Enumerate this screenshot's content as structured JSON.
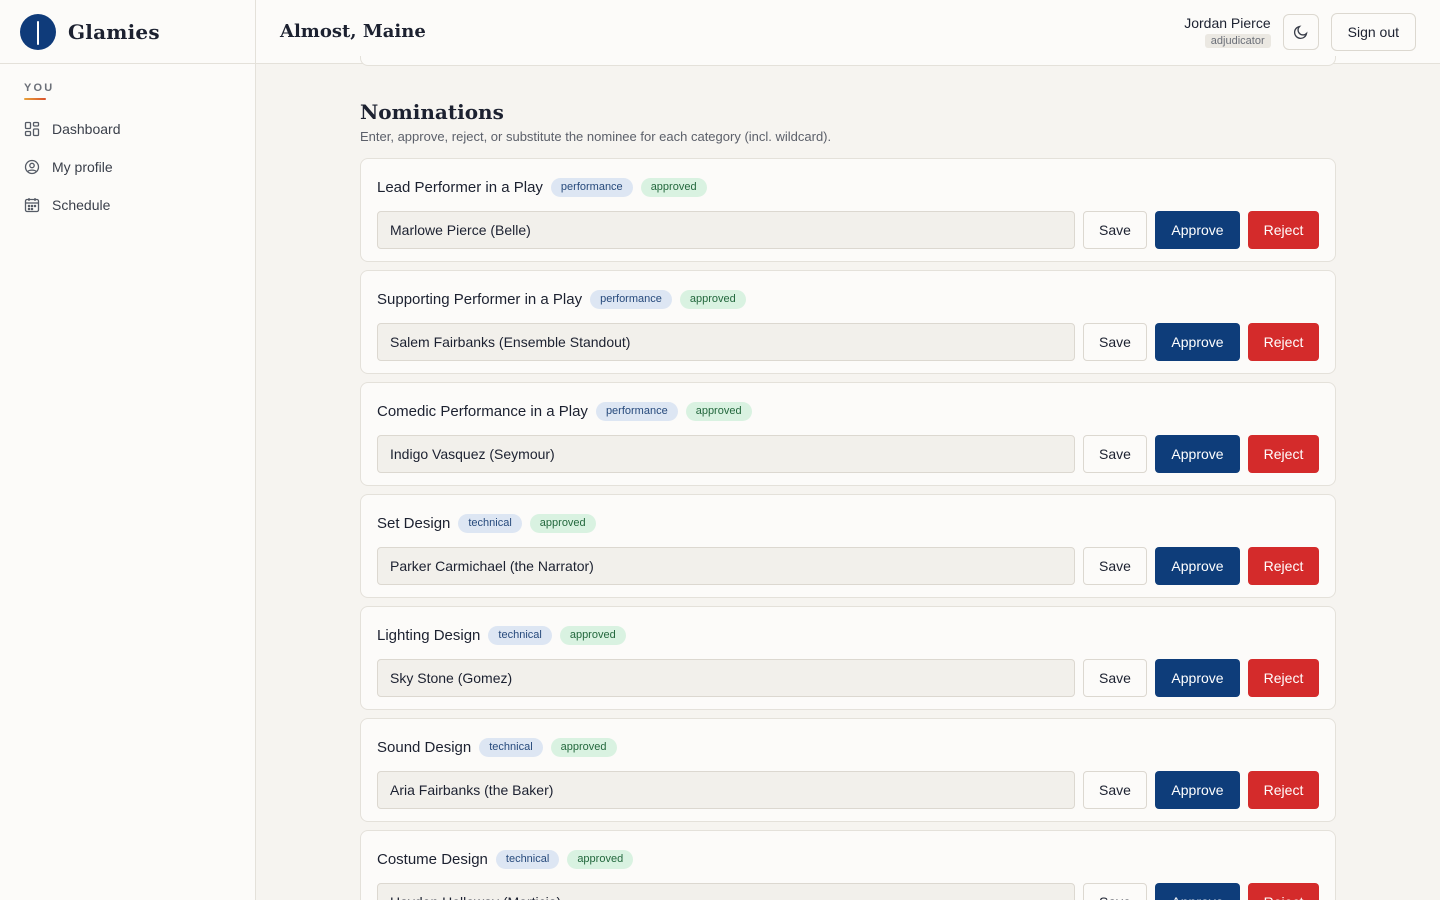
{
  "brand": {
    "name": "Glamies"
  },
  "sidebar": {
    "section_label": "YOU",
    "items": [
      {
        "label": "Dashboard",
        "icon": "grid-icon"
      },
      {
        "label": "My profile",
        "icon": "user-circle-icon"
      },
      {
        "label": "Schedule",
        "icon": "calendar-icon"
      }
    ]
  },
  "header": {
    "title": "Almost, Maine",
    "user_name": "Jordan Pierce",
    "user_role": "adjudicator",
    "theme_icon": "moon-icon",
    "signout_label": "Sign out"
  },
  "main": {
    "section_title": "Nominations",
    "section_desc": "Enter, approve, reject, or substitute the nominee for each category (incl. wildcard).",
    "buttons": {
      "save": "Save",
      "approve": "Approve",
      "reject": "Reject"
    },
    "nominations": [
      {
        "category": "Lead Performer in a Play",
        "type": "performance",
        "status": "approved",
        "nominee": "Marlowe Pierce (Belle)"
      },
      {
        "category": "Supporting Performer in a Play",
        "type": "performance",
        "status": "approved",
        "nominee": "Salem Fairbanks (Ensemble Standout)"
      },
      {
        "category": "Comedic Performance in a Play",
        "type": "performance",
        "status": "approved",
        "nominee": "Indigo Vasquez (Seymour)"
      },
      {
        "category": "Set Design",
        "type": "technical",
        "status": "approved",
        "nominee": "Parker Carmichael (the Narrator)"
      },
      {
        "category": "Lighting Design",
        "type": "technical",
        "status": "approved",
        "nominee": "Sky Stone (Gomez)"
      },
      {
        "category": "Sound Design",
        "type": "technical",
        "status": "approved",
        "nominee": "Aria Fairbanks (the Baker)"
      },
      {
        "category": "Costume Design",
        "type": "technical",
        "status": "approved",
        "nominee": "Hayden Holloway (Morticia)"
      }
    ]
  },
  "colors": {
    "primary": "#0e3d7a",
    "danger": "#d42b2b",
    "success_bg": "#d9f2e1",
    "info_bg": "#dde6f3"
  }
}
